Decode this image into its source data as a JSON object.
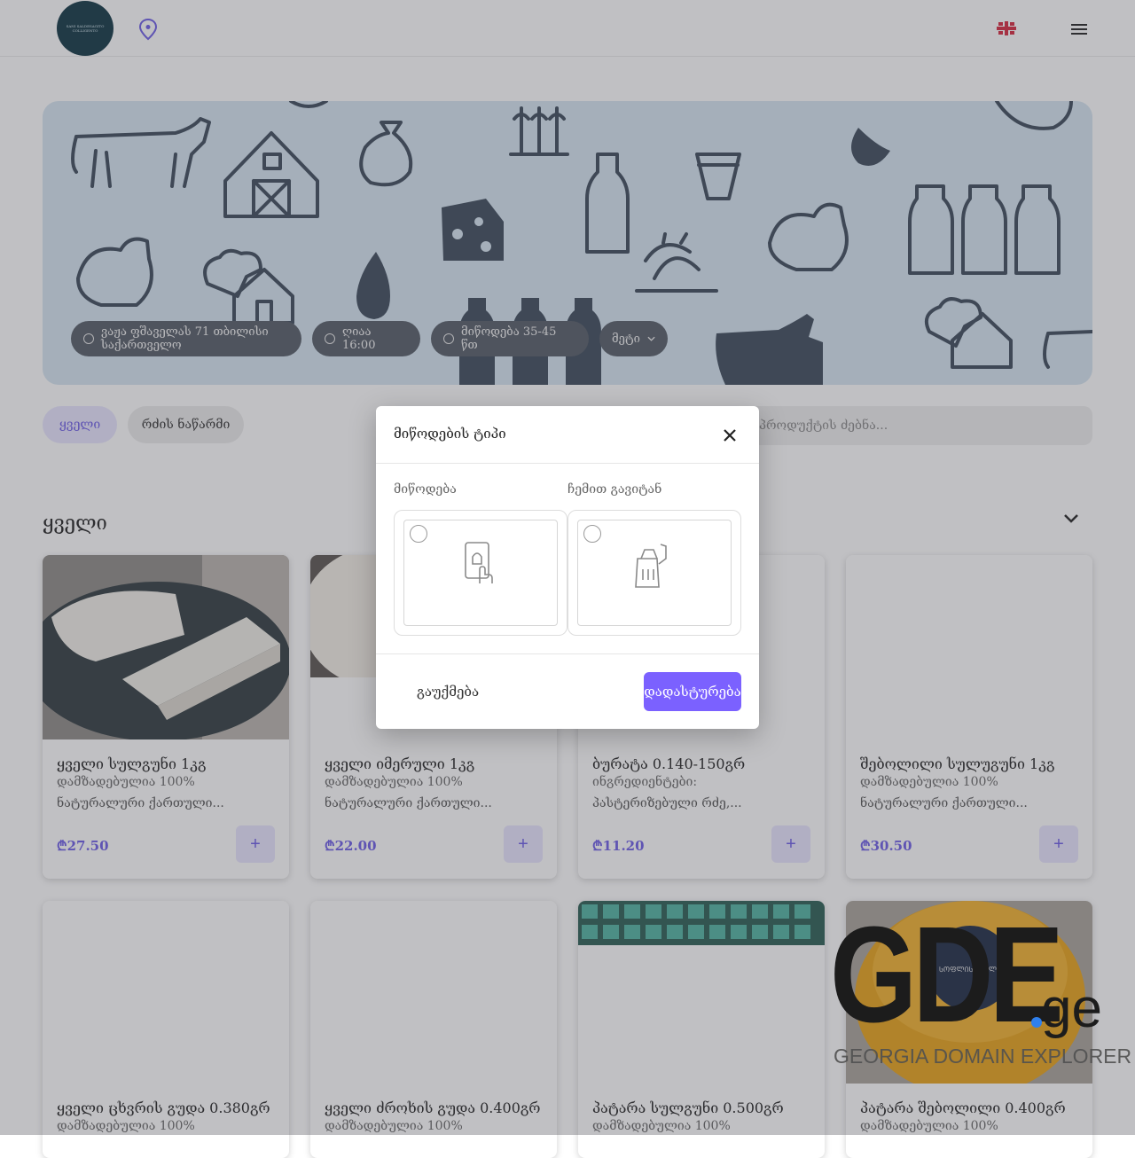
{
  "header": {
    "logo_text": "SANI SALDESAGITO COLLIGENTO",
    "location_icon": "map-pin-icon",
    "language_flag": "uk-flag-icon",
    "menu_icon": "hamburger-menu-icon"
  },
  "hero": {
    "address": "ვაჟა ფშაველას 71 თბილისი საქართველო",
    "hours": "ღიაა 16:00",
    "delivery_time": "მიწოდება 35-45 წთ",
    "more": "მეტი"
  },
  "tabs": [
    "ყველი",
    "რძის ნაწარმი"
  ],
  "search": {
    "placeholder": "პროდუქტის ძებნა..."
  },
  "section": {
    "title": "ყველი"
  },
  "products": [
    {
      "name": "ყველი სულგუნი 1კგ",
      "meta": "დამზადებულია 100%",
      "desc": "ნატურალური ქართული...",
      "price": "₾27.50"
    },
    {
      "name": "ყველი იმერული 1კგ",
      "meta": "დამზადებულია 100%",
      "desc": "ნატურალური ქართული...",
      "price": "₾22.00"
    },
    {
      "name": "ბურატა 0.140-150გრ",
      "meta": "ინგრედიენტები:",
      "desc": "პასტერიზებული რძე,...",
      "price": "₾11.20"
    },
    {
      "name": "შებოლილი სულუგუნი 1კგ",
      "meta": "დამზადებულია 100%",
      "desc": "ნატურალური ქართული...",
      "price": "₾30.50"
    },
    {
      "name": "ყველი ცხვრის გუდა 0.380გრ",
      "meta": "დამზადებულია 100%"
    },
    {
      "name": "ყველი ძროხის გუდა 0.400გრ",
      "meta": "დამზადებულია 100%"
    },
    {
      "name": "პატარა სულგუნი 0.500გრ",
      "meta": "დამზადებულია 100%"
    },
    {
      "name": "პატარა შებოლილი 0.400გრ",
      "meta": "დამზადებულია 100%"
    }
  ],
  "add_label": "+",
  "modal": {
    "title": "მიწოდების ტიპი",
    "option_delivery": "მიწოდება",
    "option_pickup": "ჩემით გავიტან",
    "cancel": "გაუქმება",
    "confirm": "დადასტურება"
  },
  "watermark": {
    "big": "GDE",
    "domain": "ge",
    "sub": "GEORGIA DOMAIN EXPLORER"
  },
  "colors": {
    "accent": "#7b61ff",
    "hero_bg": "#d6e6f2",
    "icon": "#4b5563"
  }
}
